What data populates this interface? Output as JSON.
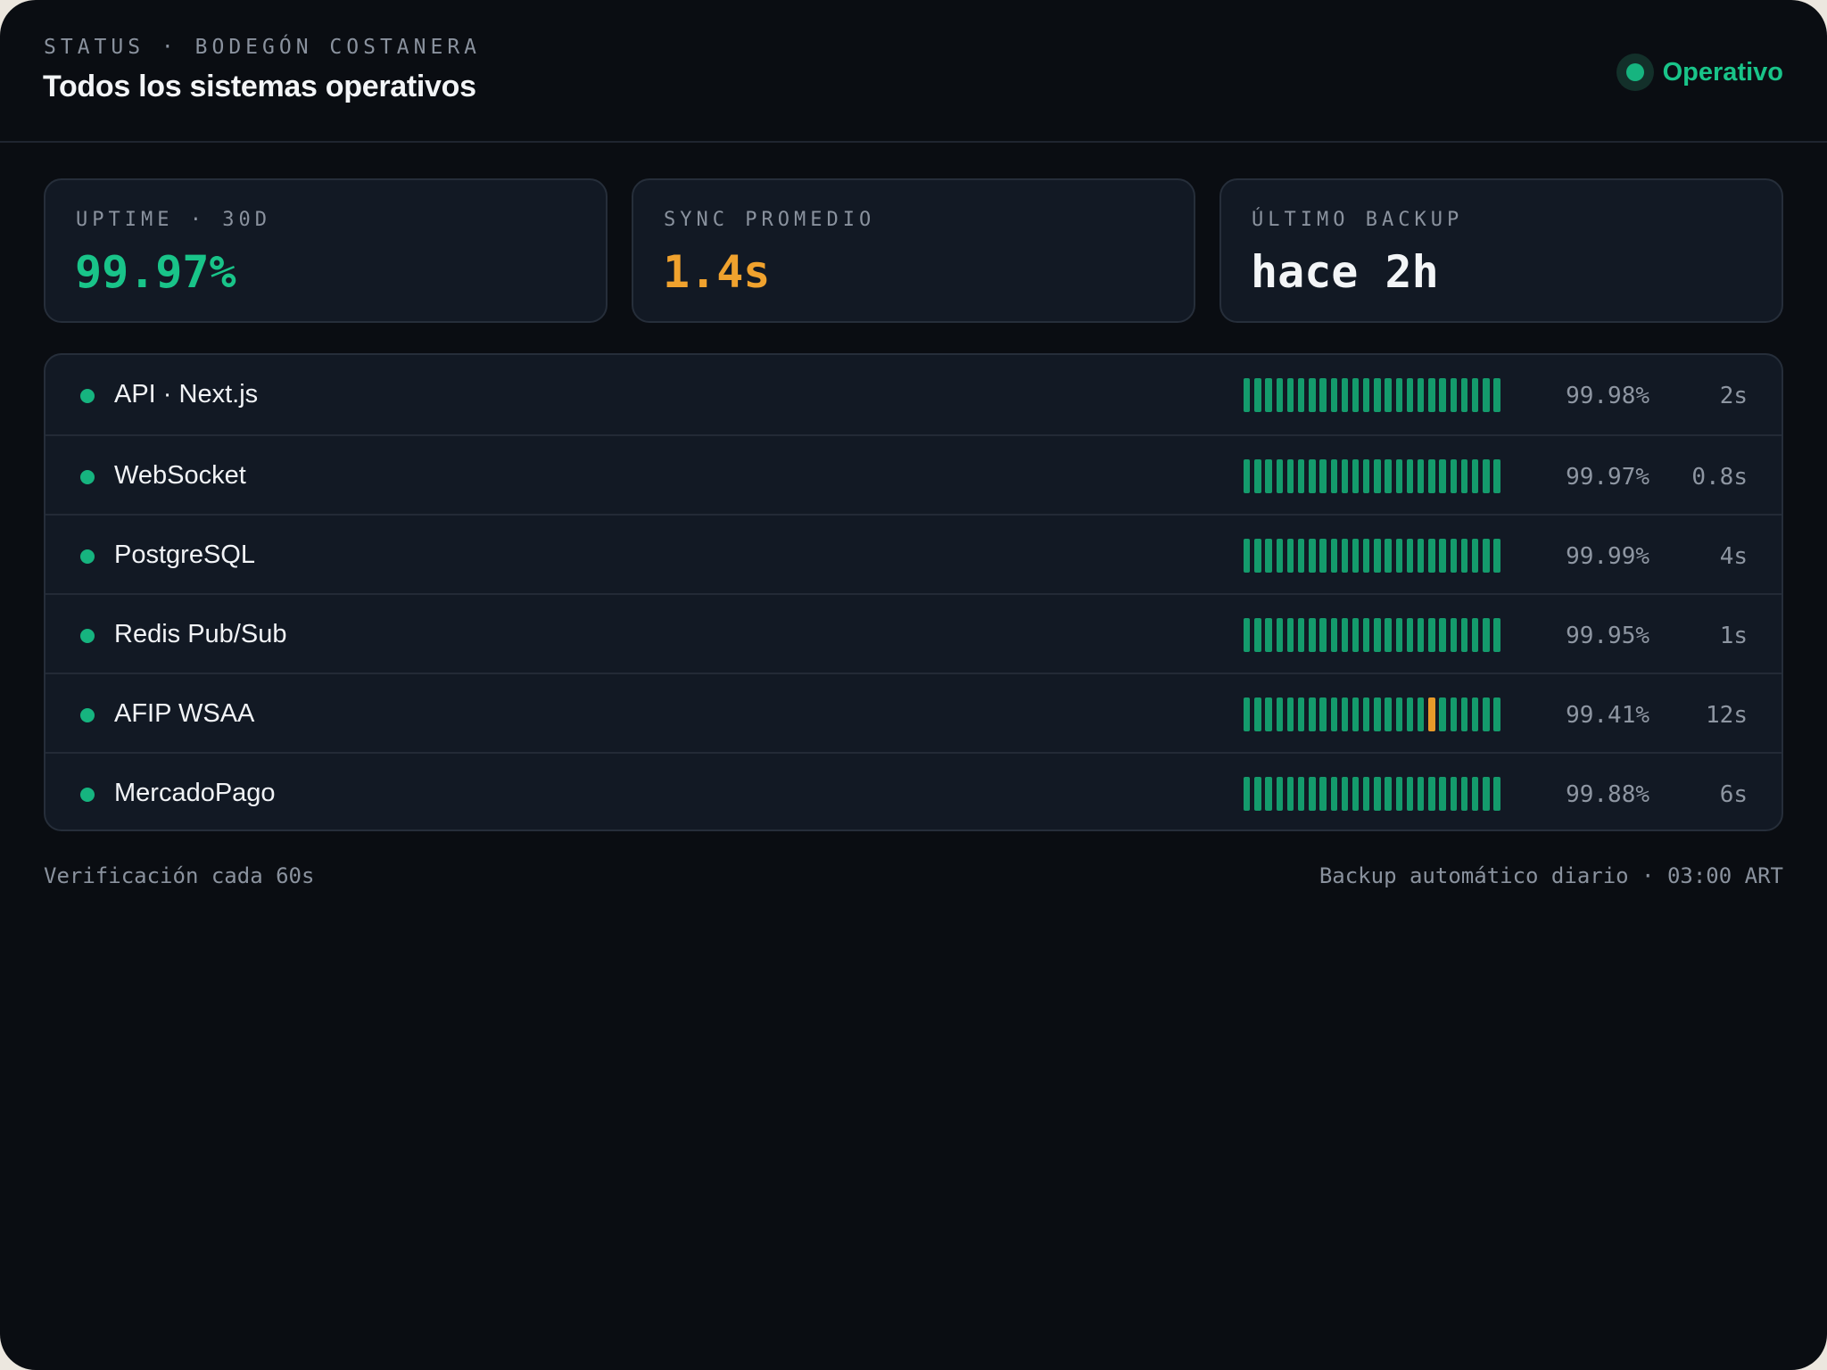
{
  "header": {
    "eyebrow": "STATUS · BODEGÓN COSTANERA",
    "title": "Todos los sistemas operativos",
    "status_label": "Operativo"
  },
  "metrics": [
    {
      "label": "UPTIME · 30D",
      "value": "99.97%",
      "color": "#19c489"
    },
    {
      "label": "SYNC PROMEDIO",
      "value": "1.4s",
      "color": "#f0a22e"
    },
    {
      "label": "ÚLTIMO BACKUP",
      "value": "hace 2h",
      "color": "#f3f5f7"
    }
  ],
  "services": [
    {
      "name": "API · Next.js",
      "uptime": "99.98%",
      "latency": "2s",
      "history": [
        "ok",
        "ok",
        "ok",
        "ok",
        "ok",
        "ok",
        "ok",
        "ok",
        "ok",
        "ok",
        "ok",
        "ok",
        "ok",
        "ok",
        "ok",
        "ok",
        "ok",
        "ok",
        "ok",
        "ok",
        "ok",
        "ok",
        "ok",
        "ok"
      ]
    },
    {
      "name": "WebSocket",
      "uptime": "99.97%",
      "latency": "0.8s",
      "history": [
        "ok",
        "ok",
        "ok",
        "ok",
        "ok",
        "ok",
        "ok",
        "ok",
        "ok",
        "ok",
        "ok",
        "ok",
        "ok",
        "ok",
        "ok",
        "ok",
        "ok",
        "ok",
        "ok",
        "ok",
        "ok",
        "ok",
        "ok",
        "ok"
      ]
    },
    {
      "name": "PostgreSQL",
      "uptime": "99.99%",
      "latency": "4s",
      "history": [
        "ok",
        "ok",
        "ok",
        "ok",
        "ok",
        "ok",
        "ok",
        "ok",
        "ok",
        "ok",
        "ok",
        "ok",
        "ok",
        "ok",
        "ok",
        "ok",
        "ok",
        "ok",
        "ok",
        "ok",
        "ok",
        "ok",
        "ok",
        "ok"
      ]
    },
    {
      "name": "Redis Pub/Sub",
      "uptime": "99.95%",
      "latency": "1s",
      "history": [
        "ok",
        "ok",
        "ok",
        "ok",
        "ok",
        "ok",
        "ok",
        "ok",
        "ok",
        "ok",
        "ok",
        "ok",
        "ok",
        "ok",
        "ok",
        "ok",
        "ok",
        "ok",
        "ok",
        "ok",
        "ok",
        "ok",
        "ok",
        "ok"
      ]
    },
    {
      "name": "AFIP WSAA",
      "uptime": "99.41%",
      "latency": "12s",
      "history": [
        "ok",
        "ok",
        "ok",
        "ok",
        "ok",
        "ok",
        "ok",
        "ok",
        "ok",
        "ok",
        "ok",
        "ok",
        "ok",
        "ok",
        "ok",
        "ok",
        "ok",
        "warn",
        "ok",
        "ok",
        "ok",
        "ok",
        "ok",
        "ok"
      ]
    },
    {
      "name": "MercadoPago",
      "uptime": "99.88%",
      "latency": "6s",
      "history": [
        "ok",
        "ok",
        "ok",
        "ok",
        "ok",
        "ok",
        "ok",
        "ok",
        "ok",
        "ok",
        "ok",
        "ok",
        "ok",
        "ok",
        "ok",
        "ok",
        "ok",
        "ok",
        "ok",
        "ok",
        "ok",
        "ok",
        "ok",
        "ok"
      ]
    }
  ],
  "colors": {
    "ok": "#149b6c",
    "warn": "#e89a2a",
    "accent": "#19c489"
  },
  "footer": {
    "left": "Verificación cada 60s",
    "right": "Backup automático diario · 03:00 ART"
  }
}
